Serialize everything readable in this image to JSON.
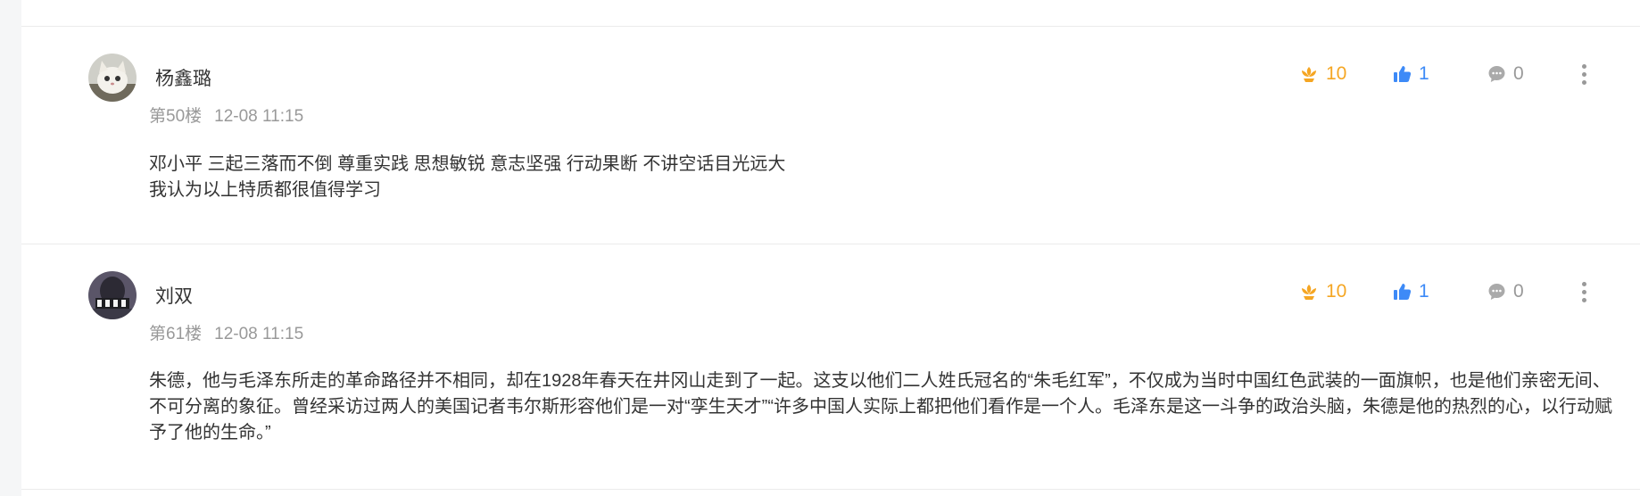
{
  "comments": [
    {
      "author": "杨鑫璐",
      "floor": "第50楼",
      "time": "12-08 11:15",
      "lines": [
        "邓小平  三起三落而不倒  尊重实践 思想敏锐 意志坚强  行动果断  不讲空话目光远大",
        "我认为以上特质都很值得学习"
      ],
      "flowers": "10",
      "likes": "1",
      "replies": "0"
    },
    {
      "author": "刘双",
      "floor": "第61楼",
      "time": "12-08 11:15",
      "lines": [
        "朱德，他与毛泽东所走的革命路径并不相同，却在1928年春天在井冈山走到了一起。这支以他们二人姓氏冠名的“朱毛红军”，不仅成为当时中国红色武装的一面旗帜，也是他们亲密无间、不可分离的象征。曾经采访过两人的美国记者韦尔斯形容他们是一对“孪生天才”“许多中国人实际上都把他们看作是一个人。毛泽东是这一斗争的政治头脑，朱德是他的热烈的心，以行动赋予了他的生命。”"
      ],
      "flowers": "10",
      "likes": "1",
      "replies": "0"
    }
  ],
  "colors": {
    "flower": "#f5a623",
    "like": "#3d8af7",
    "reply": "#999999",
    "meta": "#999999",
    "text": "#333333"
  },
  "icons": [
    "flower-icon",
    "thumbs-up-icon",
    "comment-bubble-icon",
    "more-vertical-icon"
  ]
}
